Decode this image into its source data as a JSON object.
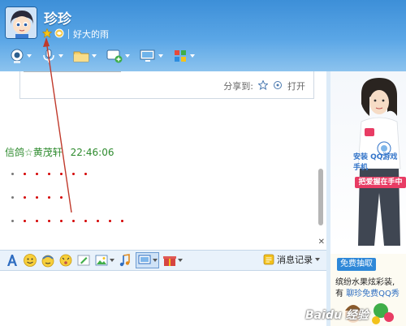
{
  "contact": {
    "name": "珍珍",
    "signature": "好大的雨"
  },
  "header_toolbar": {
    "items": [
      "video-call",
      "voice-call",
      "send-file",
      "create-discussion",
      "remote-assist",
      "apps"
    ]
  },
  "share": {
    "share_to_label": "分享到:",
    "open_label": "打开"
  },
  "message": {
    "sender": "信鸽☆黄茂轩",
    "time": "22:46:06",
    "dot_rows": [
      6,
      4,
      9
    ]
  },
  "input_toolbar": {
    "history_label": "消息记录"
  },
  "ad": {
    "qq_text": "安装 QQ游戏 手机",
    "tagline": "把爱握在手中",
    "badge": "免费抽取",
    "line1": "缤纷水果炫彩装,",
    "line2_prefix": "有",
    "line2_link": "聊珍免费QQ秀"
  },
  "watermark": "Baidu 经验",
  "colors": {
    "header_blue": "#3d8fd8",
    "sender_green": "#2e8b2e",
    "dot_red": "#d40000",
    "arrow_red": "#c0392b"
  }
}
